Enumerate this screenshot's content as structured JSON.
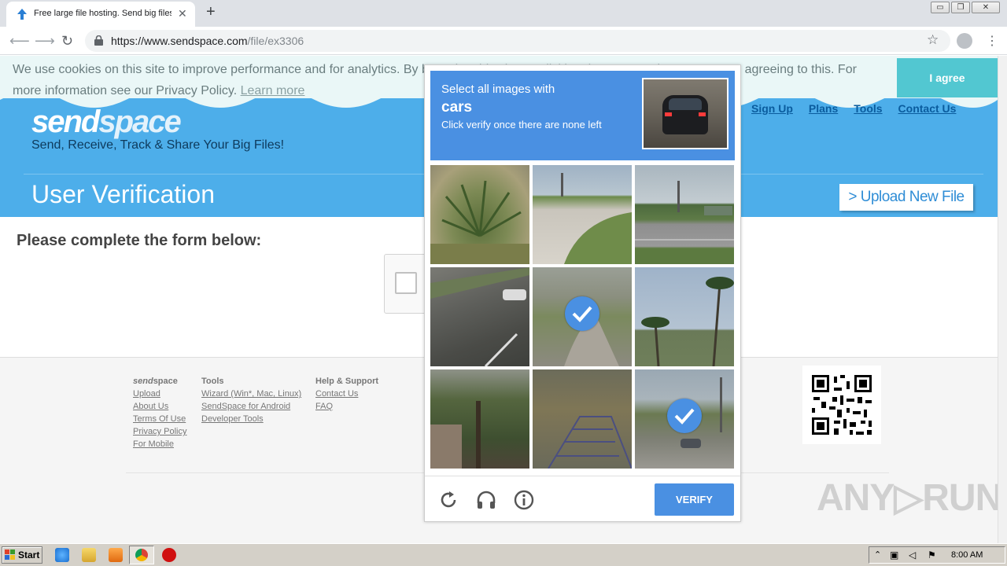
{
  "browser": {
    "tab_title": "Free large file hosting. Send big files",
    "tab_close": "✕",
    "new_tab": "+",
    "url_host": "https://www.sendspace.com",
    "url_path": "/file/ex3306",
    "window_buttons": [
      "▭",
      "❐",
      "✕"
    ]
  },
  "cookie": {
    "text": "We use cookies on this site to improve performance and for analytics. By browsing this site, or clicking the \"I agree\" button, you are agreeing to this. For more information see our Privacy Policy.",
    "learn_more": "Learn more",
    "agree": "I agree"
  },
  "site": {
    "logo_bold": "send",
    "logo_thin": "space",
    "tagline": "Send, Receive, Track & Share Your Big Files!",
    "nav": [
      "Sign Up",
      "Plans",
      "Tools",
      "Contact Us"
    ],
    "page_title": "User Verification",
    "upload_button": "> Upload New File",
    "form_heading": "Please complete the form below:"
  },
  "footer": {
    "col1_brand_bold": "send",
    "col1_brand_thin": "space",
    "col1_links": [
      "Upload",
      "About Us",
      "Terms Of Use",
      "Privacy Policy",
      "For Mobile"
    ],
    "col2_head": "Tools",
    "col2_links": [
      "Wizard (Win*, Mac, Linux)",
      "SendSpace for Android",
      "Developer Tools"
    ],
    "col3_head": "Help & Support",
    "col3_links": [
      "Contact Us",
      "FAQ"
    ],
    "watermark": "ANY▷RUN"
  },
  "captcha": {
    "line1": "Select all images with",
    "target": "cars",
    "line3": "Click verify once there are none left",
    "verify": "VERIFY",
    "tiles": [
      {
        "scene": "palm-bush",
        "selected": false
      },
      {
        "scene": "curved-road",
        "selected": false
      },
      {
        "scene": "highway-junction",
        "selected": false
      },
      {
        "scene": "road-with-car",
        "selected": false
      },
      {
        "scene": "path-grass",
        "selected": true
      },
      {
        "scene": "palm-trees-sky",
        "selected": false
      },
      {
        "scene": "trees-house",
        "selected": false
      },
      {
        "scene": "grate-ground",
        "selected": false
      },
      {
        "scene": "roadside-car",
        "selected": true
      }
    ],
    "icons": [
      "reload-icon",
      "audio-icon",
      "info-icon"
    ]
  },
  "taskbar": {
    "start": "Start",
    "clock": "8:00 AM"
  }
}
